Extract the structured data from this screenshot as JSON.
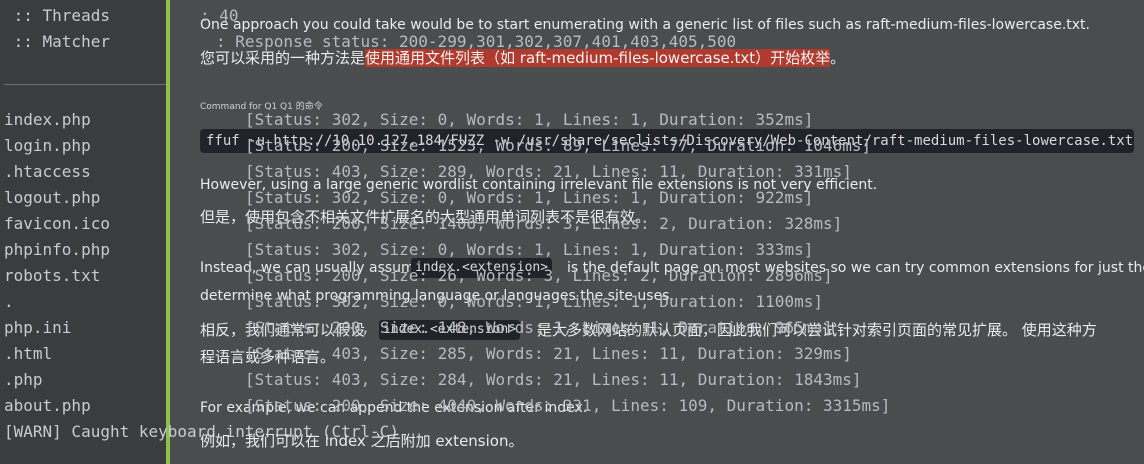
{
  "terminal": {
    "threads_label": " :: Threads",
    "matcher_label": " :: Matcher",
    "separator": "________________________________________________",
    "files": [
      "index.php",
      "login.php",
      ".htaccess",
      "logout.php",
      "favicon.ico",
      "phpinfo.php",
      "robots.txt",
      ".",
      "php.ini",
      ".html",
      ".php",
      "about.php"
    ],
    "warn": "[WARN] Caught keyboard interrupt (Ctrl-C)",
    "threads_value": ": 40",
    "matcher_value": ": Response status: 200-299,301,302,307,401,403,405,500",
    "results": [
      "[Status: 302, Size: 0, Words: 1, Lines: 1, Duration: 352ms]",
      "[Status: 200, Size: 1523, Words: 89, Lines: 77, Duration: 1046ms]",
      "[Status: 403, Size: 289, Words: 21, Lines: 11, Duration: 331ms]",
      "[Status: 302, Size: 0, Words: 1, Lines: 1, Duration: 922ms]",
      "[Status: 200, Size: 1406, Words: 3, Lines: 2, Duration: 328ms]",
      "[Status: 302, Size: 0, Words: 1, Lines: 1, Duration: 333ms]",
      "[Status: 200, Size: 26, Words: 3, Lines: 2, Duration: 2896ms]",
      "[Status: 302, Size: 0, Words: 1, Lines: 1, Duration: 1100ms]",
      "[Status: 200, Size: 148, Words: 1, Lines: 1, Duration: 965ms]",
      "[Status: 403, Size: 285, Words: 21, Lines: 11, Duration: 329ms]",
      "[Status: 403, Size: 284, Words: 21, Lines: 11, Duration: 1843ms]",
      "[Status: 200, Size: 4040, Words: 331, Lines: 109, Duration: 3315ms]"
    ]
  },
  "doc": {
    "p1_en": "One approach you could take would be to start enumerating with a generic list of files such as raft-medium-files-lowercase.txt.",
    "p1_cn_prefix": "您可以采用的一种方法是",
    "p1_cn_highlight": "使用通用文件列表（如 raft-medium-files-lowercase.txt）开始枚举",
    "p1_cn_suffix": "。",
    "command_label": "Command for Q1 Q1 的命令",
    "command": "ffuf -u http://10.10.127.184/FUZZ -w /usr/share/seclists/Discovery/Web-Content/raft-medium-files-lowercase.txt",
    "p2_en": "However, using a large generic wordlist containing irrelevant file extensions is not very efficient.",
    "p2_cn": "但是，使用包含不相关文件扩展名的大型通用单词列表不是很有效。",
    "p3_en_a": "Instead, we can usually assume",
    "p3_code": "index.<extension>",
    "p3_en_b": "is the default page on most websites so we can try common extensions for just the inde",
    "p3_en_c": "determine what programming language or languages the site uses.",
    "p3_cn_a": "相反，我们通常可以假设",
    "p3_cn_code": "index.<extension>",
    "p3_cn_b": "是大多数网站的默认页面，因此我们可以尝试针对索引页面的常见扩展。 使用这种方",
    "p3_cn_c": "程语言或多种语言。",
    "p4_en": "For example, we can append the extension after index.",
    "p4_cn": "例如，我们可以在 index 之后附加 extension。"
  },
  "colors": {
    "background": "#4a4c4e",
    "left_pane": "#3a3c3e",
    "accent": "#8bc34a",
    "highlight": "#b03a2e",
    "code_bg": "#20242a"
  }
}
